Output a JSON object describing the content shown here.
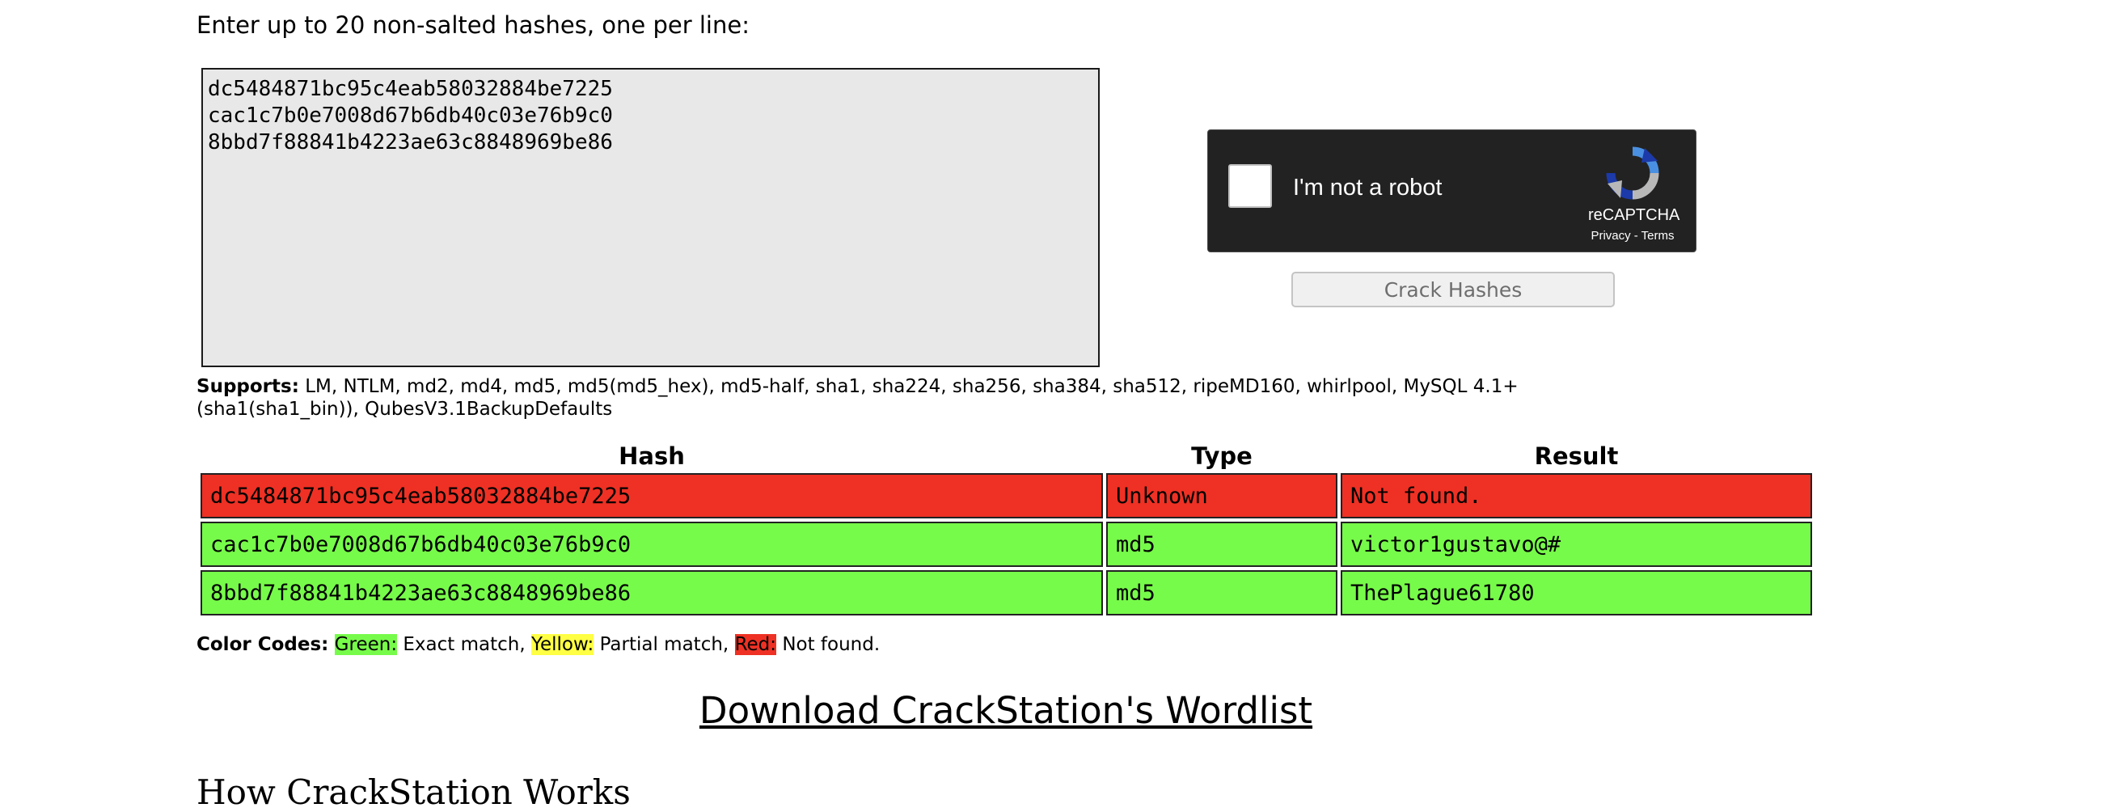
{
  "form": {
    "prompt": "Enter up to 20 non-salted hashes, one per line:",
    "hashes_input": "dc5484871bc95c4eab58032884be7225\ncac1c7b0e7008d67b6db40c03e76b9c0\n8bbd7f88841b4223ae63c8848969be86",
    "submit_label": "Crack Hashes"
  },
  "captcha": {
    "label": "I'm not a robot",
    "brand": "reCAPTCHA",
    "links": "Privacy - Terms",
    "icon": "recaptcha-logo"
  },
  "supports": {
    "label": "Supports:",
    "text": "LM, NTLM, md2, md4, md5, md5(md5_hex), md5-half, sha1, sha224, sha256, sha384, sha512, ripeMD160, whirlpool, MySQL 4.1+ (sha1(sha1_bin)), QubesV3.1BackupDefaults"
  },
  "results": {
    "headers": [
      "Hash",
      "Type",
      "Result"
    ],
    "rows": [
      {
        "hash": "dc5484871bc95c4eab58032884be7225",
        "type": "Unknown",
        "result": "Not found.",
        "status": "red"
      },
      {
        "hash": "cac1c7b0e7008d67b6db40c03e76b9c0",
        "type": "md5",
        "result": "victor1gustavo@#",
        "status": "green"
      },
      {
        "hash": "8bbd7f88841b4223ae63c8848969be86",
        "type": "md5",
        "result": "ThePlague61780",
        "status": "green"
      }
    ]
  },
  "legend": {
    "label": "Color Codes:",
    "green_key": "Green:",
    "green_text": "Exact match,",
    "yellow_key": "Yellow:",
    "yellow_text": "Partial match,",
    "red_key": "Red:",
    "red_text": "Not found."
  },
  "colors": {
    "green": "#77fb4a",
    "yellow": "#ffff44",
    "red": "#ee3124"
  },
  "download_link": "Download CrackStation's Wordlist",
  "next_heading": "How CrackStation Works"
}
